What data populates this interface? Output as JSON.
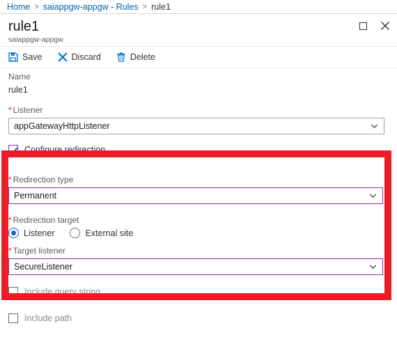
{
  "breadcrumb": {
    "items": [
      {
        "label": "Home",
        "link": true
      },
      {
        "label": "saiappgw-appgw - Rules",
        "link": true
      },
      {
        "label": "rule1",
        "link": false
      }
    ],
    "separator": ">"
  },
  "header": {
    "title": "rule1",
    "subtitle": "saiappgw-appgw",
    "maximize_tooltip": "Maximize",
    "close_tooltip": "Close"
  },
  "toolbar": {
    "save_label": "Save",
    "discard_label": "Discard",
    "delete_label": "Delete",
    "save_icon": "save-disk-icon",
    "discard_icon": "x-cross-icon",
    "delete_icon": "trash-can-icon",
    "icon_color": "#0078d4"
  },
  "form": {
    "name": {
      "label": "Name",
      "value": "rule1",
      "required": false
    },
    "listener": {
      "label": "Listener",
      "value": "appGatewayHttpListener",
      "required": true,
      "required_marker": "*"
    },
    "configure_redirection": {
      "label": "Configure redirection",
      "checked": true
    },
    "redirection_type": {
      "label": "Redirection type",
      "value": "Permanent",
      "required": true,
      "required_marker": "*"
    },
    "redirection_target": {
      "label": "Redirection target",
      "required": true,
      "required_marker": "*",
      "options": [
        {
          "label": "Listener",
          "selected": true
        },
        {
          "label": "External site",
          "selected": false
        }
      ]
    },
    "target_listener": {
      "label": "Target listener",
      "value": "SecureListener",
      "required": true,
      "required_marker": "*"
    },
    "include_query_string": {
      "label": "Include query string",
      "checked": false,
      "disabled": true
    },
    "include_path": {
      "label": "Include path",
      "checked": false,
      "disabled": true
    }
  },
  "annotation": {
    "highlight_color": "#ed1c24",
    "focus_border_color": "#8b2bb0"
  }
}
